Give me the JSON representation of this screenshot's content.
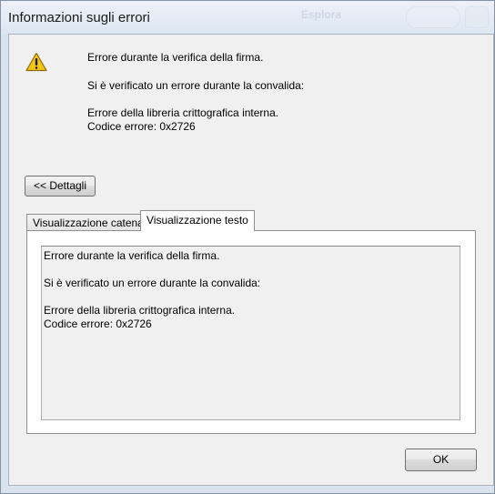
{
  "window": {
    "title": "Informazioni sugli errori"
  },
  "background": {
    "toolbar_label": "Esplora"
  },
  "message": {
    "icon": "warning-icon",
    "line1": "Errore durante la verifica della firma.",
    "line2": "Si è verificato un errore durante la convalida:",
    "line3": "Errore della libreria crittografica interna.",
    "line4": "Codice errore: 0x2726"
  },
  "details_button": {
    "label": "<< Dettagli"
  },
  "tabs": [
    {
      "label": "Visualizzazione catena",
      "active": false
    },
    {
      "label": "Visualizzazione testo",
      "active": true
    }
  ],
  "text_view": {
    "line1": "Errore durante la verifica della firma.",
    "line2": "Si è verificato un errore durante la convalida:",
    "line3": "Errore della libreria crittografica interna.",
    "line4": "Codice errore: 0x2726"
  },
  "ok_button": {
    "label": "OK"
  },
  "colors": {
    "warning_fill": "#f5c518",
    "warning_border": "#8a6d00"
  }
}
